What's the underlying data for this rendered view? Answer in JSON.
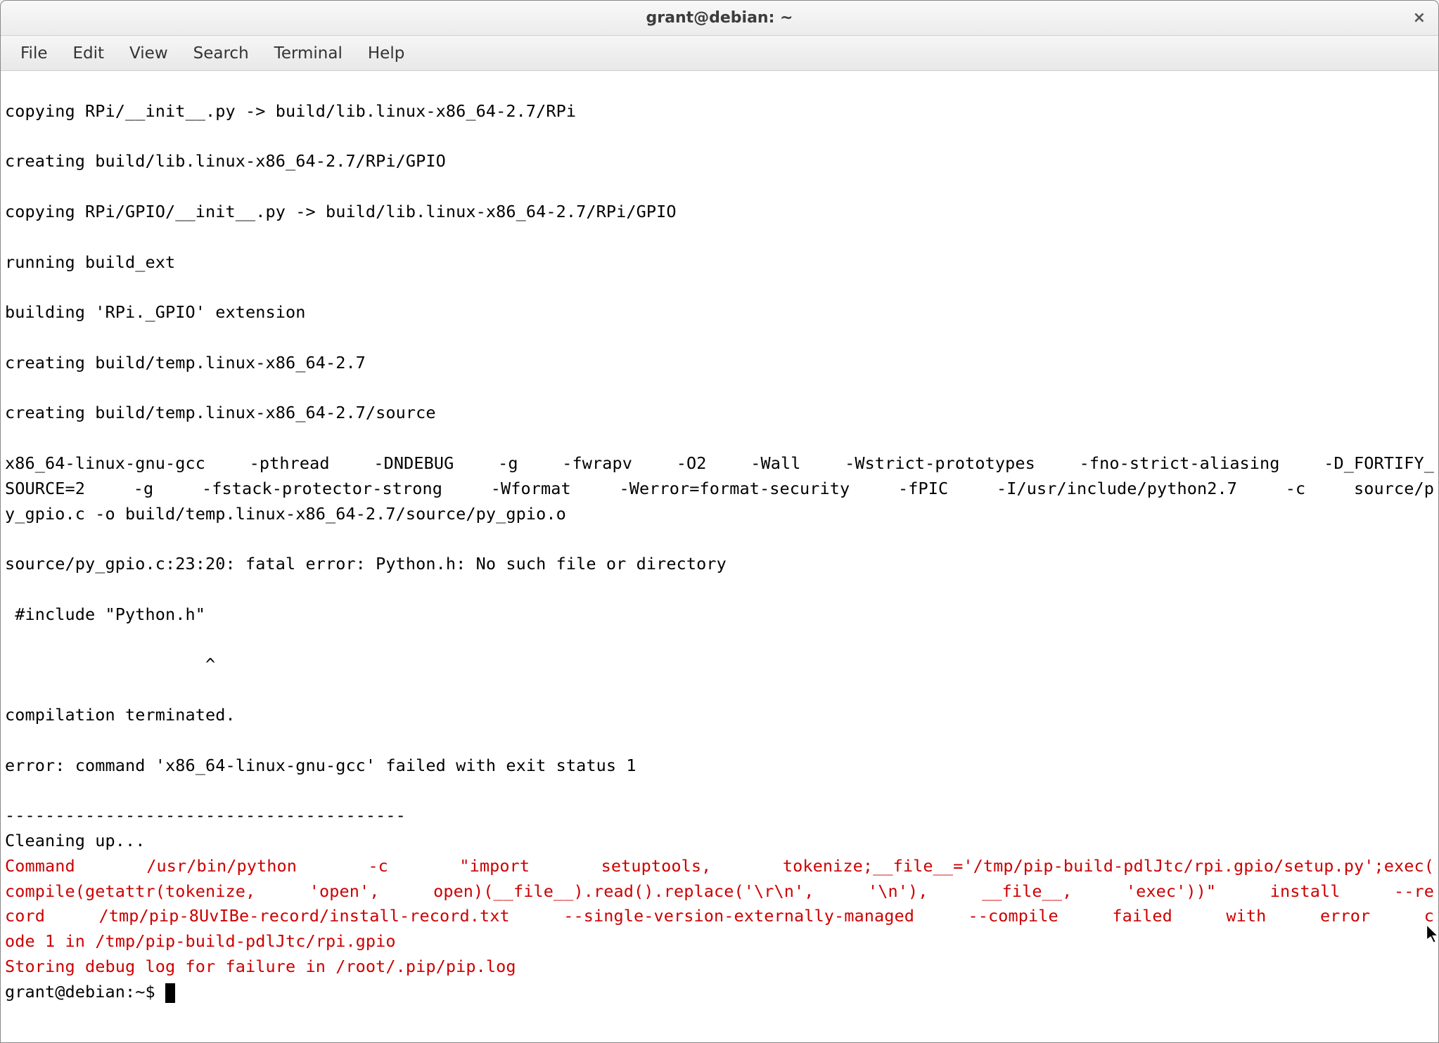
{
  "window": {
    "title": "grant@debian: ~",
    "close_glyph": "×"
  },
  "menubar": {
    "items": [
      {
        "label": "File"
      },
      {
        "label": "Edit"
      },
      {
        "label": "View"
      },
      {
        "label": "Search"
      },
      {
        "label": "Terminal"
      },
      {
        "label": "Help"
      }
    ]
  },
  "terminal": {
    "l0": "",
    "l1": "copying RPi/__init__.py -> build/lib.linux-x86_64-2.7/RPi",
    "l2": "",
    "l3": "creating build/lib.linux-x86_64-2.7/RPi/GPIO",
    "l4": "",
    "l5": "copying RPi/GPIO/__init__.py -> build/lib.linux-x86_64-2.7/RPi/GPIO",
    "l6": "",
    "l7": "running build_ext",
    "l8": "",
    "l9": "building 'RPi._GPIO' extension",
    "l10": "",
    "l11": "creating build/temp.linux-x86_64-2.7",
    "l12": "",
    "l13": "creating build/temp.linux-x86_64-2.7/source",
    "l14": "",
    "gcc1": "x86_64-linux-gnu-gcc -pthread -DNDEBUG -g -fwrapv -O2 -Wall -Wstrict-prototypes -fno-strict-aliasing -D_FORTIFY_",
    "gcc2": "SOURCE=2 -g -fstack-protector-strong -Wformat -Werror=format-security -fPIC -I/usr/include/python2.7 -c source/p",
    "gcc3": "y_gpio.c -o build/temp.linux-x86_64-2.7/source/py_gpio.o",
    "l18": "",
    "l19": "source/py_gpio.c:23:20: fatal error: Python.h: No such file or directory",
    "l20": "",
    "l21": " #include \"Python.h\"",
    "l22": "",
    "l23": "                    ^",
    "l24": "",
    "l25": "compilation terminated.",
    "l26": "",
    "l27": "error: command 'x86_64-linux-gnu-gcc' failed with exit status 1",
    "l28": "",
    "l29": "----------------------------------------",
    "l30": "Cleaning up...",
    "err1": "Command /usr/bin/python -c \"import setuptools, tokenize;__file__='/tmp/pip-build-pdlJtc/rpi.gpio/setup.py';exec(",
    "err2": "compile(getattr(tokenize, 'open', open)(__file__).read().replace('\\r\\n', '\\n'), __file__, 'exec'))\" install --re",
    "err3": "cord /tmp/pip-8UvIBe-record/install-record.txt --single-version-externally-managed --compile failed with error c",
    "err4": "ode 1 in /tmp/pip-build-pdlJtc/rpi.gpio",
    "err5": "Storing debug log for failure in /root/.pip/pip.log",
    "prompt": "grant@debian:~$ "
  }
}
